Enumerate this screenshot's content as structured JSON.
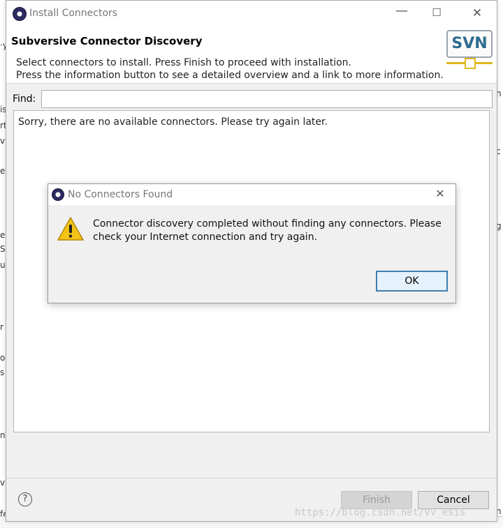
{
  "background": {
    "left_fragments": [
      "·y",
      "is",
      "rt",
      "vi",
      "e",
      "e",
      "Sy",
      "u",
      "r",
      "o",
      "s",
      "n",
      "vi",
      "fe"
    ],
    "right_fragments": [
      "n",
      "c",
      "g",
      "n"
    ]
  },
  "window": {
    "title": "Install Connectors",
    "minimize_glyph": "—",
    "maximize_glyph": "☐",
    "close_glyph": "✕"
  },
  "header": {
    "title": "Subversive Connector Discovery",
    "desc_line1": "Select connectors to install. Press Finish to proceed with installation.",
    "desc_line2": "Press the information button to see a detailed overview and a link to more information.",
    "logo_text": "SVN"
  },
  "find": {
    "label": "Find:",
    "value": ""
  },
  "list": {
    "empty_message": "Sorry, there are no available connectors.  Please try again later."
  },
  "footer": {
    "help_glyph": "?",
    "finish_label": "Finish",
    "cancel_label": "Cancel",
    "watermark": "https://blog.csdn.net/Vv_esis"
  },
  "dialog": {
    "title": "No Connectors Found",
    "close_glyph": "✕",
    "message_line1": "Connector discovery completed without finding any connectors.  Please",
    "message_line2": "check your Internet connection and try again.",
    "ok_label": "OK",
    "icon": "warning-icon"
  },
  "colors": {
    "accent": "#3c7fb1",
    "svn_text": "#2e6c8f",
    "svn_bar": "#e0b820",
    "warning_fill": "#f2c318"
  }
}
